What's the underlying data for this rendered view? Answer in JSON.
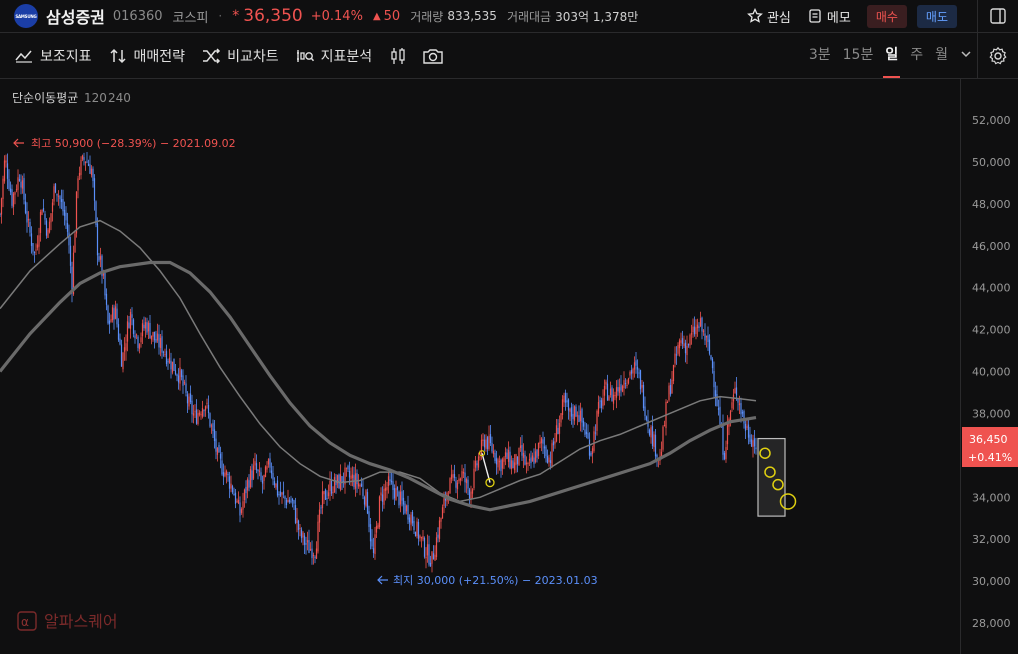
{
  "header": {
    "logo_text": "SAMSUNG",
    "stock_name": "삼성증권",
    "stock_code": "016360",
    "market": "코스피",
    "bullet": "·",
    "star": "*",
    "price": "36,350",
    "change_pct": "+0.14%",
    "change_arrow": "▲",
    "change_amt": "50",
    "volume_label": "거래량",
    "volume": "833,535",
    "value_label": "거래대금",
    "value": "303억 1,378만",
    "watch_label": "관심",
    "memo_label": "메모",
    "buy_label": "매수",
    "sell_label": "매도"
  },
  "toolbar": {
    "indicator": "보조지표",
    "strategy": "매매전략",
    "compare": "비교차트",
    "analysis": "지표분석",
    "periods": [
      "3분",
      "15분",
      "일",
      "주",
      "월"
    ],
    "active_period": "일"
  },
  "colors": {
    "up": "#ef5350",
    "down": "#5b8ff9",
    "ma120": "#7a7a7a",
    "ma240": "#6a6a6a",
    "highlight": "#e0d010",
    "bg": "#0f0f10"
  },
  "chart_data": {
    "type": "candlestick",
    "indicator_title": "단순이동평균",
    "ma_periods": [
      "120",
      "240"
    ],
    "ylim": [
      27000,
      53500
    ],
    "y_ticks": [
      "52,000",
      "50,000",
      "48,000",
      "46,000",
      "44,000",
      "42,000",
      "40,000",
      "38,000",
      "36,000",
      "34,000",
      "32,000",
      "30,000",
      "28,000"
    ],
    "y_tick_values": [
      52000,
      50000,
      48000,
      46000,
      44000,
      42000,
      40000,
      38000,
      36000,
      34000,
      32000,
      30000,
      28000
    ],
    "high_label": "최고 50,900 (−28.39%) − 2021.09.02",
    "high_value": 50900,
    "low_label": "최지 30,000 (+21.50%) − 2023.01.03",
    "low_value": 30000,
    "current_price_label": "36,450",
    "current_change_label": "+0.41%",
    "current_value": 36450,
    "close_anchors": [
      [
        0,
        47500
      ],
      [
        5,
        50200
      ],
      [
        12,
        48200
      ],
      [
        20,
        49500
      ],
      [
        28,
        47000
      ],
      [
        35,
        45500
      ],
      [
        42,
        48000
      ],
      [
        48,
        46500
      ],
      [
        55,
        49000
      ],
      [
        60,
        48200
      ],
      [
        67,
        47000
      ],
      [
        72,
        44200
      ],
      [
        78,
        49500
      ],
      [
        85,
        50200
      ],
      [
        92,
        49600
      ],
      [
        97,
        46000
      ],
      [
        103,
        44500
      ],
      [
        108,
        42200
      ],
      [
        115,
        43000
      ],
      [
        122,
        40500
      ],
      [
        130,
        42800
      ],
      [
        138,
        41500
      ],
      [
        146,
        42300
      ],
      [
        155,
        41500
      ],
      [
        162,
        41200
      ],
      [
        170,
        40500
      ],
      [
        180,
        39800
      ],
      [
        188,
        38500
      ],
      [
        195,
        37800
      ],
      [
        205,
        38600
      ],
      [
        212,
        37200
      ],
      [
        218,
        35800
      ],
      [
        225,
        35200
      ],
      [
        232,
        34500
      ],
      [
        240,
        33200
      ],
      [
        248,
        34800
      ],
      [
        255,
        35400
      ],
      [
        262,
        34600
      ],
      [
        270,
        35600
      ],
      [
        278,
        34200
      ],
      [
        285,
        33900
      ],
      [
        292,
        33800
      ],
      [
        300,
        32200
      ],
      [
        308,
        31600
      ],
      [
        315,
        31500
      ],
      [
        322,
        33800
      ],
      [
        330,
        34500
      ],
      [
        338,
        34700
      ],
      [
        345,
        35000
      ],
      [
        352,
        34900
      ],
      [
        360,
        34600
      ],
      [
        367,
        33800
      ],
      [
        373,
        31000
      ],
      [
        380,
        33900
      ],
      [
        388,
        34600
      ],
      [
        395,
        34300
      ],
      [
        402,
        33700
      ],
      [
        410,
        33200
      ],
      [
        418,
        32300
      ],
      [
        425,
        31500
      ],
      [
        432,
        31000
      ],
      [
        440,
        32800
      ],
      [
        448,
        34500
      ],
      [
        455,
        34800
      ],
      [
        462,
        35100
      ],
      [
        470,
        34200
      ],
      [
        478,
        35800
      ],
      [
        485,
        36800
      ],
      [
        492,
        36300
      ],
      [
        500,
        35600
      ],
      [
        507,
        35900
      ],
      [
        514,
        35500
      ],
      [
        521,
        36100
      ],
      [
        528,
        35300
      ],
      [
        535,
        36000
      ],
      [
        542,
        36600
      ],
      [
        550,
        35800
      ],
      [
        557,
        37200
      ],
      [
        564,
        38500
      ],
      [
        570,
        37900
      ],
      [
        577,
        38200
      ],
      [
        584,
        37300
      ],
      [
        591,
        36200
      ],
      [
        598,
        38100
      ],
      [
        606,
        39100
      ],
      [
        613,
        38800
      ],
      [
        620,
        39400
      ],
      [
        627,
        39800
      ],
      [
        634,
        40200
      ],
      [
        640,
        39600
      ],
      [
        647,
        37800
      ],
      [
        654,
        36600
      ],
      [
        660,
        35800
      ],
      [
        667,
        38500
      ],
      [
        674,
        40200
      ],
      [
        680,
        41500
      ],
      [
        687,
        41200
      ],
      [
        694,
        41900
      ],
      [
        700,
        42200
      ],
      [
        706,
        41500
      ],
      [
        712,
        40400
      ],
      [
        718,
        38200
      ],
      [
        724,
        36100
      ],
      [
        730,
        38000
      ],
      [
        736,
        39200
      ],
      [
        740,
        38400
      ],
      [
        745,
        37400
      ],
      [
        750,
        37000
      ],
      [
        756,
        36450
      ]
    ],
    "ma120_anchors": [
      [
        0,
        43000
      ],
      [
        30,
        44800
      ],
      [
        60,
        46100
      ],
      [
        80,
        46900
      ],
      [
        100,
        47200
      ],
      [
        120,
        46700
      ],
      [
        140,
        45900
      ],
      [
        160,
        44800
      ],
      [
        180,
        43500
      ],
      [
        200,
        41800
      ],
      [
        220,
        40200
      ],
      [
        240,
        38800
      ],
      [
        260,
        37500
      ],
      [
        280,
        36400
      ],
      [
        300,
        35600
      ],
      [
        320,
        35000
      ],
      [
        340,
        34700
      ],
      [
        360,
        34800
      ],
      [
        380,
        35200
      ],
      [
        400,
        35200
      ],
      [
        420,
        34900
      ],
      [
        440,
        34200
      ],
      [
        460,
        33800
      ],
      [
        480,
        34000
      ],
      [
        500,
        34400
      ],
      [
        520,
        34800
      ],
      [
        540,
        35100
      ],
      [
        560,
        35700
      ],
      [
        580,
        36300
      ],
      [
        600,
        36700
      ],
      [
        620,
        37000
      ],
      [
        640,
        37400
      ],
      [
        660,
        37800
      ],
      [
        680,
        38200
      ],
      [
        700,
        38600
      ],
      [
        720,
        38800
      ],
      [
        740,
        38700
      ],
      [
        756,
        38600
      ]
    ],
    "ma240_anchors": [
      [
        0,
        40000
      ],
      [
        30,
        41800
      ],
      [
        60,
        43300
      ],
      [
        80,
        44200
      ],
      [
        100,
        44700
      ],
      [
        120,
        45000
      ],
      [
        150,
        45200
      ],
      [
        170,
        45200
      ],
      [
        190,
        44700
      ],
      [
        210,
        43800
      ],
      [
        230,
        42600
      ],
      [
        250,
        41200
      ],
      [
        270,
        39800
      ],
      [
        290,
        38500
      ],
      [
        310,
        37400
      ],
      [
        330,
        36600
      ],
      [
        350,
        36000
      ],
      [
        370,
        35600
      ],
      [
        390,
        35300
      ],
      [
        410,
        34900
      ],
      [
        430,
        34400
      ],
      [
        450,
        33900
      ],
      [
        470,
        33600
      ],
      [
        490,
        33400
      ],
      [
        510,
        33600
      ],
      [
        530,
        33800
      ],
      [
        550,
        34100
      ],
      [
        570,
        34400
      ],
      [
        590,
        34700
      ],
      [
        610,
        35000
      ],
      [
        630,
        35300
      ],
      [
        650,
        35600
      ],
      [
        670,
        36100
      ],
      [
        690,
        36700
      ],
      [
        710,
        37200
      ],
      [
        730,
        37600
      ],
      [
        756,
        37800
      ]
    ],
    "annotation_circles": [
      {
        "x": 765,
        "y": 36100
      },
      {
        "x": 770,
        "y": 35200
      },
      {
        "x": 778,
        "y": 34600
      },
      {
        "x": 788,
        "y": 33800
      }
    ],
    "annotation_box": {
      "x_start": 758,
      "x_end": 785,
      "y_top": 36800,
      "y_bottom": 33100
    },
    "annotation_line": {
      "x1": 482,
      "y1": 36100,
      "x2": 490,
      "y2": 34700
    }
  },
  "watermark": "알파스퀘어"
}
